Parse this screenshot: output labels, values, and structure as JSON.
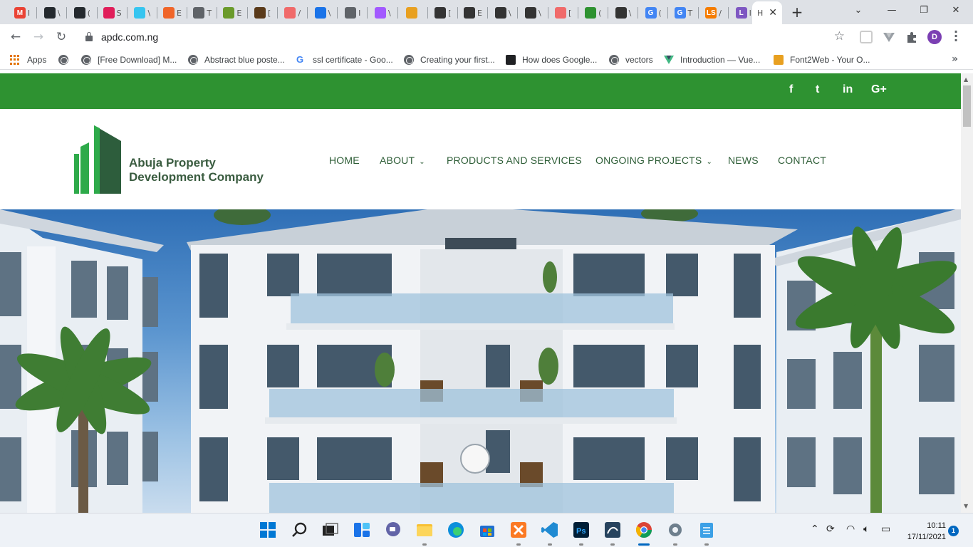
{
  "browser": {
    "tabs": [
      {
        "icon": "gmail-icon",
        "letter": "M",
        "color": "#ea4335",
        "char": "I"
      },
      {
        "icon": "github-icon",
        "letter": "",
        "color": "#24292e",
        "char": "\\"
      },
      {
        "icon": "github-icon",
        "letter": "",
        "color": "#24292e",
        "char": "("
      },
      {
        "icon": "slack-icon",
        "letter": "",
        "color": "#e01e5a",
        "char": "S"
      },
      {
        "icon": "slack-icon",
        "letter": "",
        "color": "#36c5f0",
        "char": "\\"
      },
      {
        "icon": "codepen-icon",
        "letter": "",
        "color": "#f06529",
        "char": "E"
      },
      {
        "icon": "globe-icon",
        "letter": "",
        "color": "#5f6368",
        "char": "T"
      },
      {
        "icon": "africa-map-icon",
        "letter": "",
        "color": "#6a9a2a",
        "char": "E"
      },
      {
        "icon": "site-icon",
        "letter": "",
        "color": "#5a3a1a",
        "char": "["
      },
      {
        "icon": "oval-icon",
        "letter": "",
        "color": "#f06a6a",
        "char": "/"
      },
      {
        "icon": "diamond-icon",
        "letter": "",
        "color": "#1a73e8",
        "char": "\\"
      },
      {
        "icon": "globe-icon",
        "letter": "",
        "color": "#5f6368",
        "char": "I"
      },
      {
        "icon": "figma-icon",
        "letter": "",
        "color": "#a259ff",
        "char": "\\"
      },
      {
        "icon": "pma-icon",
        "letter": "",
        "color": "#e8a020",
        "char": ""
      },
      {
        "icon": "site-icon",
        "letter": "",
        "color": "#333",
        "char": "["
      },
      {
        "icon": "site-icon",
        "letter": "",
        "color": "#333",
        "char": "E"
      },
      {
        "icon": "site-icon",
        "letter": "",
        "color": "#333",
        "char": "\\"
      },
      {
        "icon": "site-icon",
        "letter": "",
        "color": "#333",
        "char": "\\"
      },
      {
        "icon": "oval-icon",
        "letter": "",
        "color": "#f06a6a",
        "char": "["
      },
      {
        "icon": "qr-icon",
        "letter": "",
        "color": "#2e9231",
        "char": "("
      },
      {
        "icon": "site-icon",
        "letter": "",
        "color": "#333",
        "char": "\\"
      },
      {
        "icon": "google-icon",
        "letter": "G",
        "color": "#4285f4",
        "char": "("
      },
      {
        "icon": "google-icon",
        "letter": "G",
        "color": "#4285f4",
        "char": "T"
      },
      {
        "icon": "ls-icon",
        "letter": "LS",
        "color": "#f57c00",
        "char": "/"
      },
      {
        "icon": "l-icon",
        "letter": "L",
        "color": "#7e57c2",
        "char": "I"
      }
    ],
    "active_tab": {
      "char": "H"
    },
    "new_tab_label": "+",
    "window_controls": {
      "dropdown": "⌄",
      "minimize": "—",
      "restore": "❐",
      "close": "✕"
    },
    "address": "apdc.com.ng",
    "profile_initial": "D",
    "bookmarks": [
      {
        "label": "Apps",
        "icon": "apps-grid-icon"
      },
      {
        "label": "",
        "icon": "globe-icon"
      },
      {
        "label": "[Free Download] M...",
        "icon": "globe-icon"
      },
      {
        "label": "Abstract blue poste...",
        "icon": "globe-icon"
      },
      {
        "label": "ssl certificate - Goo...",
        "icon": "google-icon"
      },
      {
        "label": "Creating your first...",
        "icon": "globe-icon"
      },
      {
        "label": "How does Google...",
        "icon": "medium-icon"
      },
      {
        "label": "vectors",
        "icon": "globe-icon"
      },
      {
        "label": "Introduction — Vue...",
        "icon": "vue-icon"
      },
      {
        "label": "Font2Web - Your O...",
        "icon": "font2web-icon"
      }
    ],
    "bookmarks_overflow": "»"
  },
  "site": {
    "social": [
      "f",
      "t",
      "in",
      "G+"
    ],
    "logo_line1": "Abuja Property",
    "logo_line2": "Development Company",
    "nav": [
      {
        "label": "HOME",
        "dropdown": false
      },
      {
        "label": "ABOUT",
        "dropdown": true
      },
      {
        "label": "PRODUCTS AND SERVICES",
        "dropdown": false
      },
      {
        "label": "ONGOING PROJECTS",
        "dropdown": true
      },
      {
        "label": "NEWS",
        "dropdown": false
      },
      {
        "label": "CONTACT",
        "dropdown": false
      }
    ],
    "caret": "⌄",
    "colors": {
      "green": "#2e9231",
      "logo_dark": "#3a5c40",
      "nav_text": "#2d5d36"
    }
  },
  "taskbar": {
    "apps": [
      "start-icon",
      "search-icon",
      "task-view-icon",
      "widgets-icon",
      "chat-icon",
      "file-explorer-icon",
      "edge-icon",
      "store-icon",
      "xampp-icon",
      "vscode-icon",
      "photoshop-icon",
      "mysql-workbench-icon",
      "chrome-icon",
      "settings-icon",
      "notepad-icon"
    ],
    "time": "10:11",
    "date": "17/11/2021",
    "notifications": "1"
  }
}
